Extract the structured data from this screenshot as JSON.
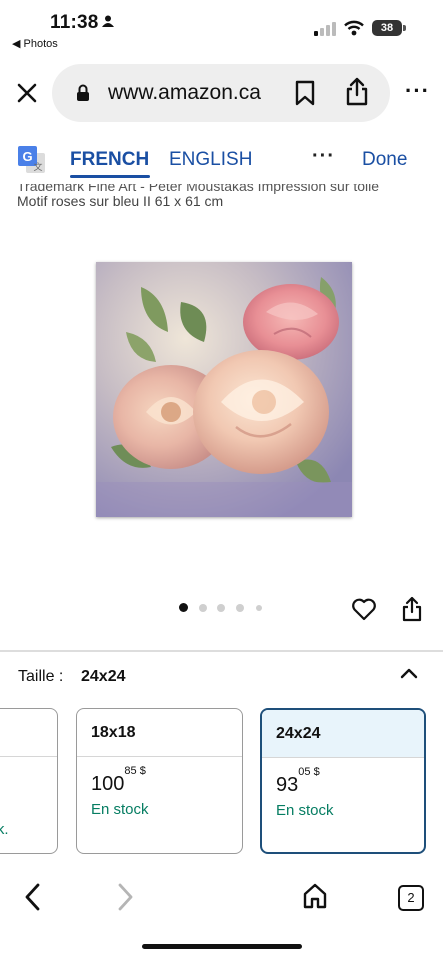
{
  "status": {
    "time": "11:38",
    "back_app": "◀ Photos",
    "battery": "38"
  },
  "browser": {
    "url": "www.amazon.ca"
  },
  "translate": {
    "tab_source": "FRENCH",
    "tab_target": "ENGLISH",
    "more": "···",
    "done": "Done"
  },
  "product": {
    "title_clipped": "Trademark Fine Art - Peter Moustakas Impression sur toile",
    "title": "Motif roses sur bleu II 61 x 61 cm",
    "image_count": 5,
    "image_index": 1
  },
  "size": {
    "label": "Taille :",
    "selected": "24x24",
    "options": [
      {
        "name": "",
        "price_whole": "",
        "price_cents": "",
        "currency": "",
        "stock": "ock."
      },
      {
        "name": "18x18",
        "price_whole": "100",
        "price_cents": "85",
        "currency": "$",
        "stock": "En stock"
      },
      {
        "name": "24x24",
        "price_whole": "93",
        "price_cents": "05",
        "currency": "$",
        "stock": "En stock"
      }
    ]
  },
  "nav": {
    "tabs_count": "2"
  },
  "colors": {
    "link_blue": "#1a4fa3",
    "in_stock_green": "#067d62",
    "selected_border": "#1e4f7a"
  }
}
